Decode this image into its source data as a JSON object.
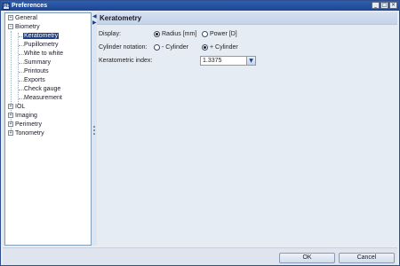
{
  "window": {
    "title": "Preferences",
    "app_icon": "HS",
    "minimize": "_",
    "maximize": "□",
    "close": "×"
  },
  "tree": {
    "items": [
      {
        "label": "General",
        "expander": "+",
        "level": 0
      },
      {
        "label": "Biometry",
        "expander": "−",
        "level": 0
      },
      {
        "label": "Keratometry",
        "level": 1,
        "selected": true
      },
      {
        "label": "Pupillometry",
        "level": 1
      },
      {
        "label": "White to white",
        "level": 1
      },
      {
        "label": "Summary",
        "level": 1
      },
      {
        "label": "Printouts",
        "level": 1
      },
      {
        "label": "Exports",
        "level": 1
      },
      {
        "label": "Check gauge",
        "level": 1
      },
      {
        "label": "Measurement",
        "level": 1
      },
      {
        "label": "IOL",
        "expander": "+",
        "level": 0
      },
      {
        "label": "Imaging",
        "expander": "+",
        "level": 0
      },
      {
        "label": "Perimetry",
        "expander": "+",
        "level": 0
      },
      {
        "label": "Tonometry",
        "expander": "+",
        "level": 0
      }
    ]
  },
  "splitter": {
    "collapse_left": "◀",
    "collapse_right": "▶"
  },
  "panel": {
    "title": "Keratometry",
    "display": {
      "label": "Display:",
      "option_radius": "Radius [mm]",
      "option_power": "Power [D]",
      "selected": "Radius [mm]"
    },
    "cylinder": {
      "label": "Cylinder notation:",
      "option_minus": "- Cylinder",
      "option_plus": "+ Cylinder",
      "selected": "+ Cylinder"
    },
    "index": {
      "label": "Keratometric index:",
      "value": "1.3375",
      "arrow": "▼"
    }
  },
  "footer": {
    "ok_label": "OK",
    "cancel_label": "Cancel"
  }
}
